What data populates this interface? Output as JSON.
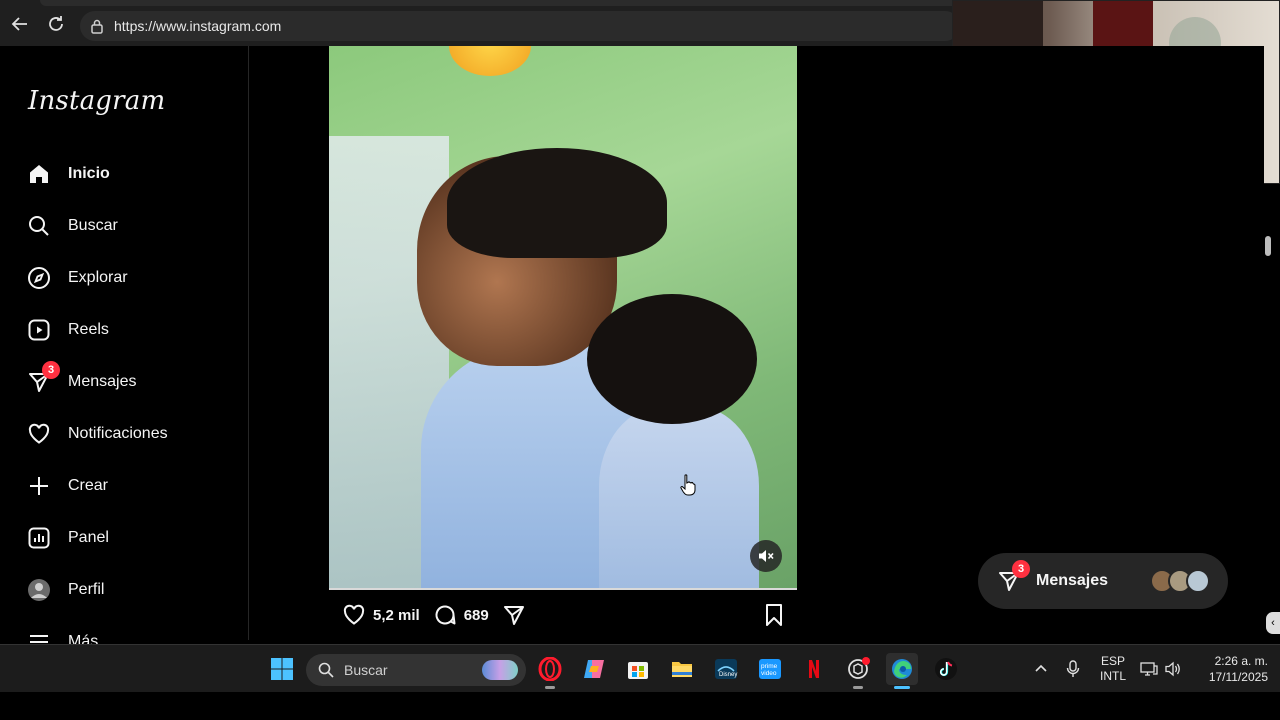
{
  "browser": {
    "url": "https://www.instagram.com"
  },
  "sidebar": {
    "logo": "Instagram",
    "items": [
      {
        "label": "Inicio",
        "icon": "home-icon"
      },
      {
        "label": "Buscar",
        "icon": "search-icon"
      },
      {
        "label": "Explorar",
        "icon": "compass-icon"
      },
      {
        "label": "Reels",
        "icon": "reels-icon"
      },
      {
        "label": "Mensajes",
        "icon": "messenger-icon",
        "badge": "3"
      },
      {
        "label": "Notificaciones",
        "icon": "heart-icon"
      },
      {
        "label": "Crear",
        "icon": "plus-icon"
      },
      {
        "label": "Panel",
        "icon": "chart-icon"
      },
      {
        "label": "Perfil",
        "icon": "avatar"
      },
      {
        "label": "Más",
        "icon": "menu-icon"
      }
    ]
  },
  "post": {
    "likes": "5,2 mil",
    "comments": "689"
  },
  "messages_pill": {
    "label": "Mensajes",
    "badge": "3"
  },
  "taskbar": {
    "search_label": "Buscar",
    "lang_line1": "ESP",
    "lang_line2": "INTL",
    "time": "2:26 a. m.",
    "date": "17/11/2025"
  },
  "colors": {
    "badge": "#ff3040",
    "background": "#000000",
    "pill": "#262626",
    "edge_accent": "#4cc2ff"
  }
}
